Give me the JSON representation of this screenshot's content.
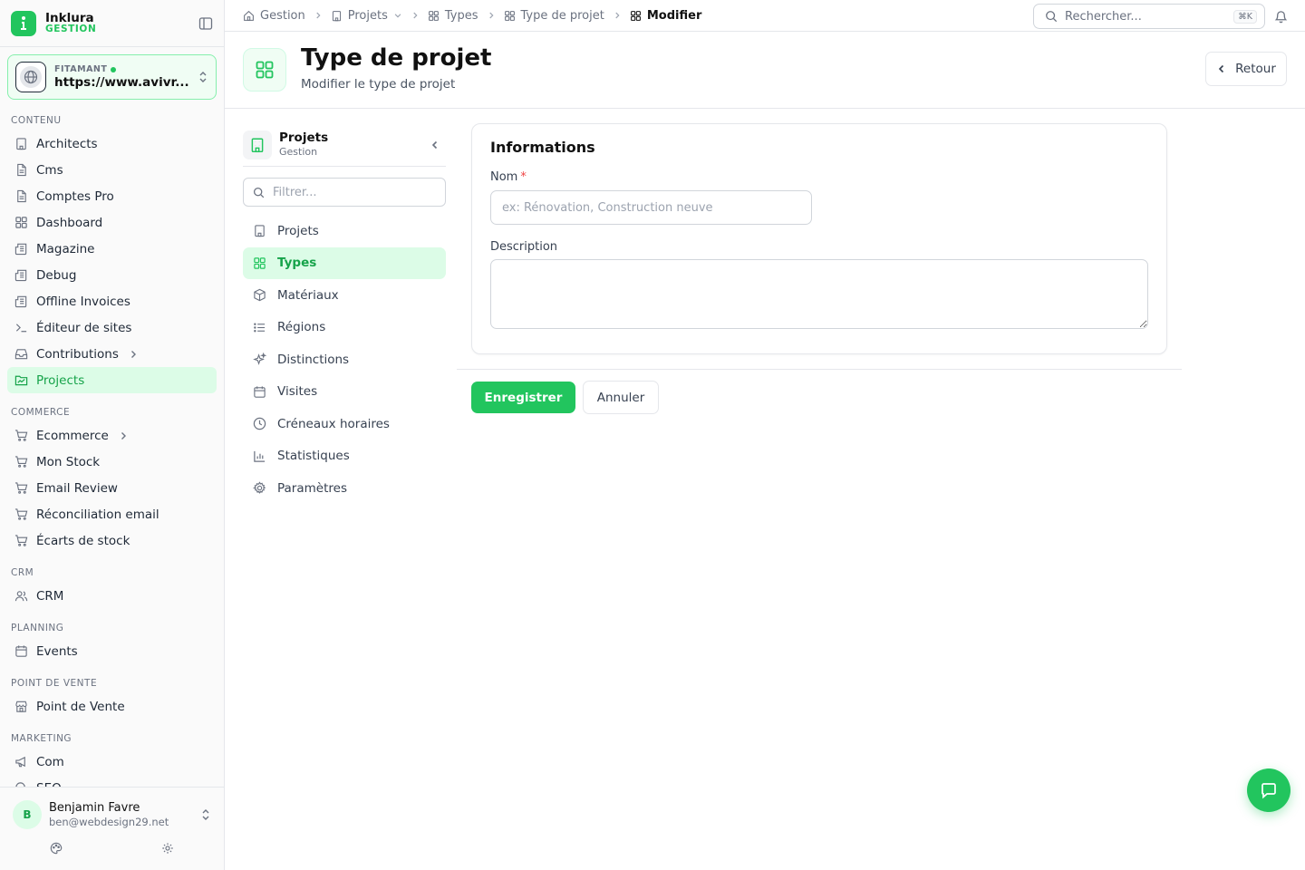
{
  "brand": {
    "name": "Inklura",
    "sub": "GESTION"
  },
  "site": {
    "label": "FITAMANT",
    "url": "https://www.avivr..."
  },
  "sidebar": {
    "sections": [
      {
        "label": "CONTENU",
        "items": [
          {
            "label": "Architects",
            "icon": "building-icon"
          },
          {
            "label": "Cms",
            "icon": "file-icon"
          },
          {
            "label": "Comptes Pro",
            "icon": "file-icon"
          },
          {
            "label": "Dashboard",
            "icon": "grid-icon"
          },
          {
            "label": "Magazine",
            "icon": "newspaper-icon"
          },
          {
            "label": "Debug",
            "icon": "newspaper-icon"
          },
          {
            "label": "Offline Invoices",
            "icon": "newspaper-icon"
          },
          {
            "label": "Éditeur de sites",
            "icon": "terminal-icon"
          },
          {
            "label": "Contributions",
            "icon": "inbox-icon"
          },
          {
            "label": "Projects",
            "icon": "folder-icon"
          }
        ]
      },
      {
        "label": "COMMERCE",
        "items": [
          {
            "label": "Ecommerce",
            "icon": "cart-icon"
          },
          {
            "label": "Mon Stock",
            "icon": "cart-icon"
          },
          {
            "label": "Email Review",
            "icon": "cart-icon"
          },
          {
            "label": "Réconciliation email",
            "icon": "cart-icon"
          },
          {
            "label": "Écarts de stock",
            "icon": "cart-icon"
          }
        ]
      },
      {
        "label": "CRM",
        "items": [
          {
            "label": "CRM",
            "icon": "users-icon"
          }
        ]
      },
      {
        "label": "PLANNING",
        "items": [
          {
            "label": "Events",
            "icon": "calendar-icon"
          }
        ]
      },
      {
        "label": "POINT DE VENTE",
        "items": [
          {
            "label": "Point de Vente",
            "icon": "store-icon"
          }
        ]
      },
      {
        "label": "MARKETING",
        "items": [
          {
            "label": "Com",
            "icon": "megaphone-icon"
          },
          {
            "label": "SEO",
            "icon": "search-icon"
          }
        ]
      }
    ],
    "active": "Projects"
  },
  "user": {
    "initial": "B",
    "name": "Benjamin Favre",
    "email": "ben@webdesign29.net"
  },
  "breadcrumb": [
    {
      "label": "Gestion",
      "icon": "home-icon"
    },
    {
      "label": "Projets",
      "icon": "building-icon"
    },
    {
      "label": "Types",
      "icon": "grid-icon"
    },
    {
      "label": "Type de projet",
      "icon": "grid-icon"
    },
    {
      "label": "Modifier",
      "icon": "grid-icon"
    }
  ],
  "search": {
    "placeholder": "Rechercher...",
    "shortcut": "⌘K"
  },
  "page": {
    "title": "Type de projet",
    "subtitle": "Modifier le type de projet",
    "back_label": "Retour"
  },
  "subnav": {
    "title": "Projets",
    "sub": "Gestion",
    "filter_placeholder": "Filtrer...",
    "items": [
      {
        "label": "Projets",
        "icon": "building-icon"
      },
      {
        "label": "Types",
        "icon": "grid-icon"
      },
      {
        "label": "Matériaux",
        "icon": "box-icon"
      },
      {
        "label": "Régions",
        "icon": "list-icon"
      },
      {
        "label": "Distinctions",
        "icon": "sparkle-icon"
      },
      {
        "label": "Visites",
        "icon": "calendar-icon"
      },
      {
        "label": "Créneaux horaires",
        "icon": "clock-icon"
      },
      {
        "label": "Statistiques",
        "icon": "chart-icon"
      },
      {
        "label": "Paramètres",
        "icon": "gear-icon"
      }
    ],
    "active": "Types"
  },
  "form": {
    "title": "Informations",
    "nom_label": "Nom",
    "nom_required": "*",
    "nom_placeholder": "ex: Rénovation, Construction neuve",
    "nom_value": "",
    "description_label": "Description",
    "description_value": "",
    "save_label": "Enregistrer",
    "cancel_label": "Annuler"
  },
  "colors": {
    "accent": "#22c55e",
    "accent_light": "#dcfce7",
    "accent_text": "#16a34a"
  }
}
